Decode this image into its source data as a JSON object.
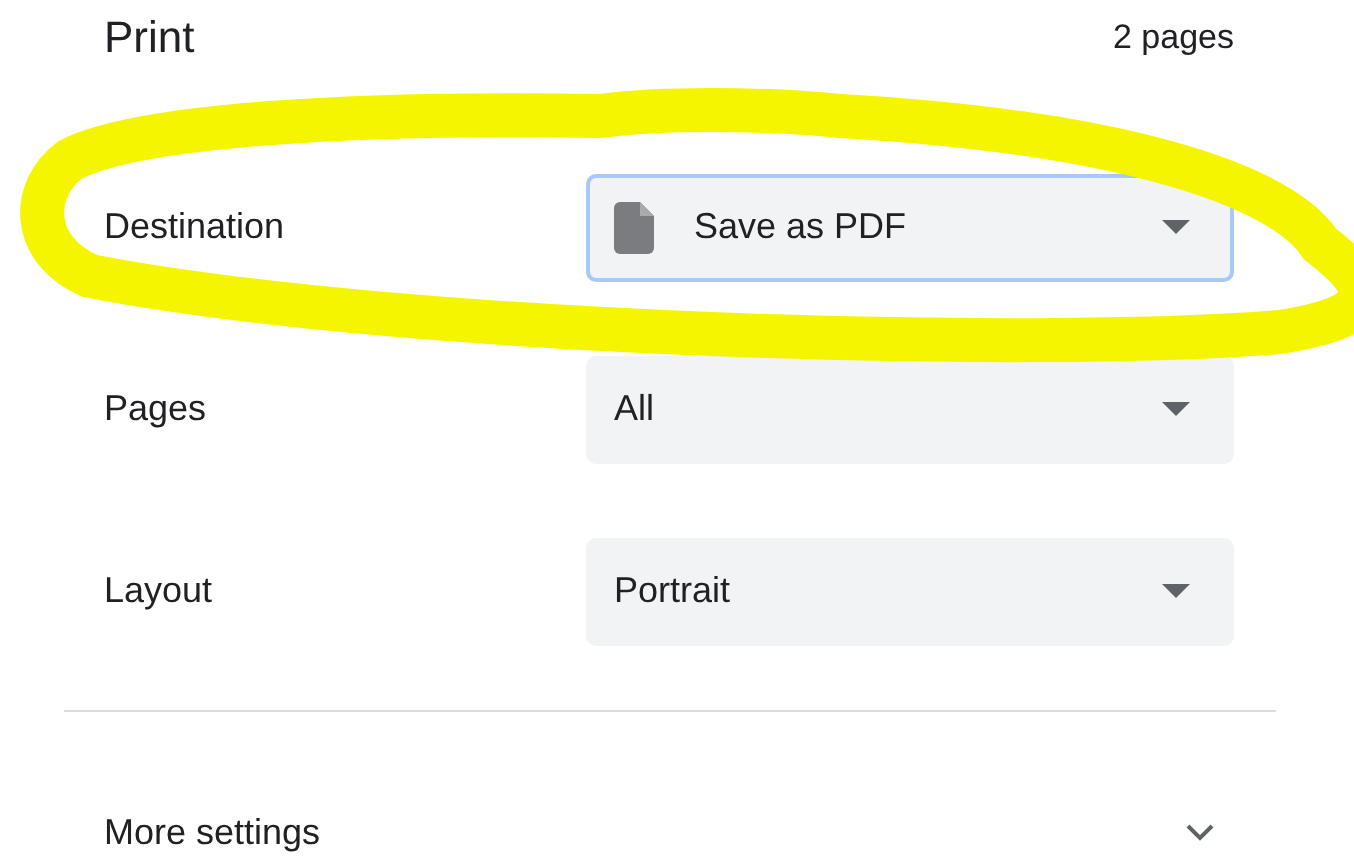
{
  "header": {
    "title": "Print",
    "page_count": "2 pages"
  },
  "settings": [
    {
      "label": "Destination",
      "kind": "icon-select",
      "value": "Save as PDF",
      "focused": true
    },
    {
      "label": "Pages",
      "kind": "select",
      "value": "All",
      "focused": false
    },
    {
      "label": "Layout",
      "kind": "select",
      "value": "Portrait",
      "focused": false
    }
  ],
  "more_settings": {
    "label": "More settings",
    "expanded": false
  },
  "annotation": {
    "kind": "scribble"
  }
}
